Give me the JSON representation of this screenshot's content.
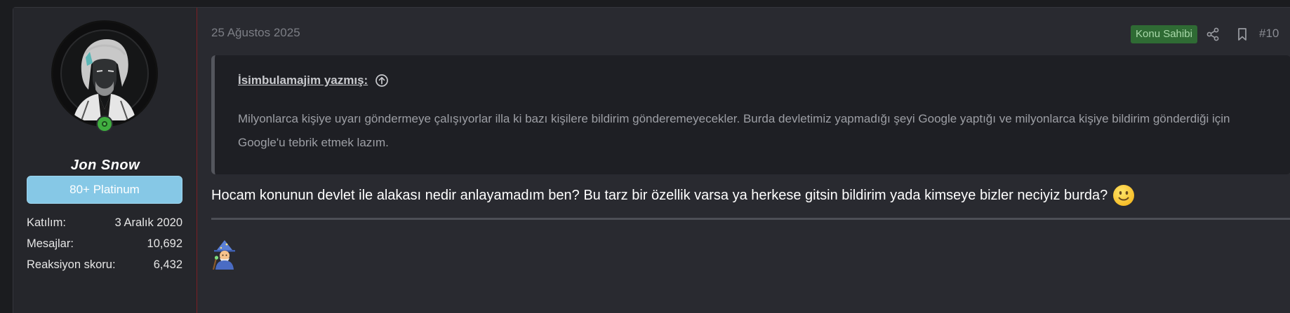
{
  "user": {
    "name": "Jon Snow",
    "banner": "80+ Platinum",
    "avatar_icon": "portrait-avatar",
    "online_status": "online",
    "stats": [
      {
        "label": "Katılım:",
        "value": "3 Aralık 2020"
      },
      {
        "label": "Mesajlar:",
        "value": "10,692"
      },
      {
        "label": "Reaksiyon skoru:",
        "value": "6,432"
      }
    ]
  },
  "post": {
    "date": "25 Ağustos 2025",
    "owner_badge": "Konu Sahibi",
    "number": "#10",
    "share_icon": "share-icon",
    "bookmark_icon": "bookmark-icon"
  },
  "quote": {
    "author": "İsimbulamajim yazmış:",
    "text": "Milyonlarca kişiye uyarı göndermeye çalışıyorlar illa ki bazı kişilere bildirim gönderemeyecekler. Burda devletimiz yapmadığı şeyi Google yaptığı ve milyonlarca kişiye bildirim gönderdiği için Google'u tebrik etmek lazım."
  },
  "message": {
    "text": "Hocam konunun devlet ile alakası nedir anlayamadım ben? Bu tarz bir özellik varsa ya herkese gitsin bildirim yada kimseye bizler neciyiz burda?",
    "emoji": "slightly-smiling-face"
  },
  "signature": {
    "emoji": "mage"
  },
  "colors": {
    "page_bg": "#1b1c1f",
    "post_bg": "#292a30",
    "sidebar_bg": "#25262b",
    "sidebar_border": "#7a1f24",
    "banner_bg": "#86c8e6",
    "owner_badge_bg": "#2f6b34",
    "online_green": "#3fae3f",
    "quote_bg": "#1e1f24"
  }
}
